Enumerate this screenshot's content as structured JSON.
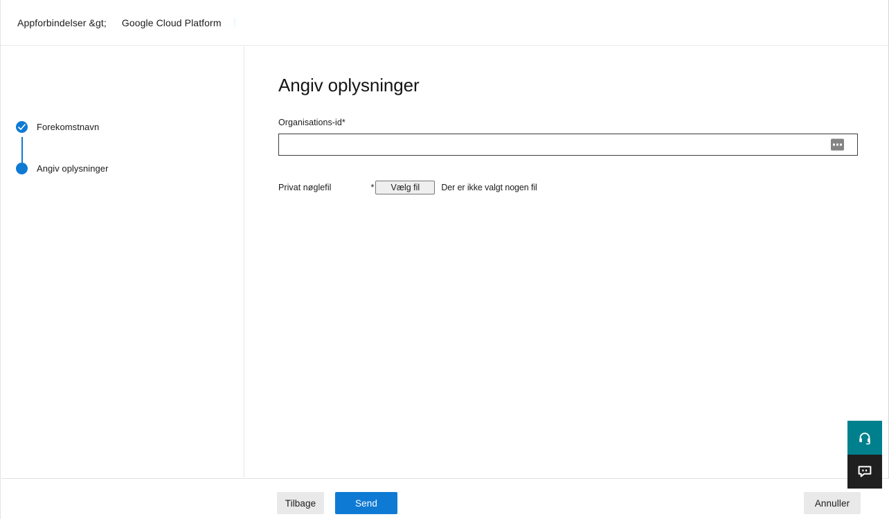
{
  "header": {
    "breadcrumb_root": "Appforbindelser &gt;",
    "breadcrumb_current": "Google Cloud Platform"
  },
  "sidebar": {
    "steps": [
      {
        "label": "Forekomstnavn",
        "state": "completed",
        "icon": "check-circle-icon"
      },
      {
        "label": "Angiv oplysninger",
        "state": "current",
        "icon": "filled-circle-icon"
      }
    ]
  },
  "main": {
    "title": "Angiv oplysninger",
    "org_field": {
      "label": "Organisations-id",
      "required_marker": "*",
      "value": "",
      "placeholder": "",
      "picker_icon": "ellipsis-icon"
    },
    "key_field": {
      "label": "Privat nøglefil",
      "required_marker": "*",
      "choose_button": "Vælg fil",
      "status": "Der er ikke valgt nogen fil"
    }
  },
  "footer": {
    "back_label": "Tilbage",
    "submit_label": "Send",
    "cancel_label": "Annuller"
  },
  "widgets": {
    "support_icon": "headset-icon",
    "chat_icon": "chat-bubble-icon"
  },
  "colors": {
    "accent_blue": "#0f7ad4",
    "support_teal": "#00808d",
    "chat_black": "#1f1f1f",
    "neutral_button": "#e9e9e9"
  }
}
